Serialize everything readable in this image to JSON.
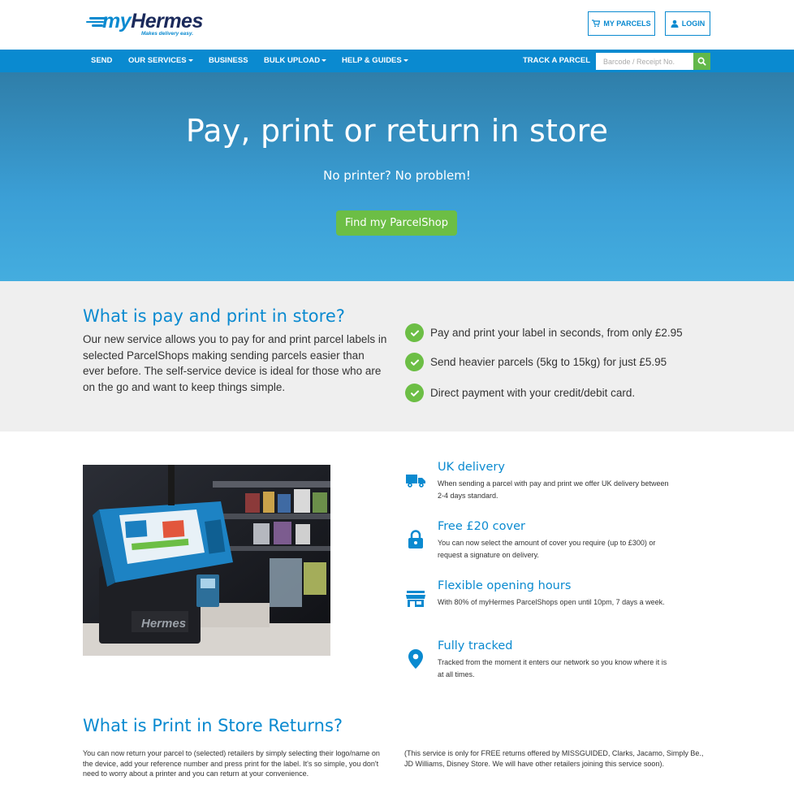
{
  "header": {
    "logo_text_my": "my",
    "logo_text_brand": "Hermes",
    "logo_tagline": "Makes delivery easy.",
    "my_parcels_label": "MY PARCELS",
    "login_label": "LOGIN"
  },
  "nav": {
    "items": [
      {
        "label": "SEND",
        "dropdown": false
      },
      {
        "label": "OUR SERVICES",
        "dropdown": true
      },
      {
        "label": "BUSINESS",
        "dropdown": false
      },
      {
        "label": "BULK UPLOAD",
        "dropdown": true
      },
      {
        "label": "HELP & GUIDES",
        "dropdown": true
      }
    ],
    "track_label": "TRACK A PARCEL",
    "track_placeholder": "Barcode / Receipt No.",
    "track_icon": "search-icon"
  },
  "hero": {
    "title": "Pay, print or return in store",
    "subtitle": "No printer? No problem!",
    "button_label": "Find my ParcelShop"
  },
  "info": {
    "title": "What is pay and print in store?",
    "text": "Our new service allows you to pay for and print parcel labels in selected ParcelShops making sending parcels easier than ever before. The self-service device is ideal for those who are on the go and want to keep things simple.",
    "checks": [
      "Pay and print your label in seconds, from only £2.95",
      "Send heavier parcels (5kg to 15kg) for just £5.95",
      "Direct payment with your credit/debit card."
    ]
  },
  "photo": {
    "kiosk_brand": "Hermes"
  },
  "features": [
    {
      "icon": "truck-icon",
      "title": "UK delivery",
      "text": "When sending a parcel with pay and print we offer UK delivery between 2-4 days standard."
    },
    {
      "icon": "lock-icon",
      "title": "Free £20 cover",
      "text": "You can now select the amount of cover you require (up to £300) or request a signature on delivery."
    },
    {
      "icon": "store-icon",
      "title": "Flexible opening hours",
      "text": "With 80% of myHermes ParcelShops open until 10pm, 7 days a week."
    },
    {
      "icon": "map-pin-icon",
      "title": "Fully tracked",
      "text": "Tracked from the moment it enters our network so you know where it is at all times."
    }
  ],
  "returns": {
    "title": "What is Print in Store Returns?",
    "left_text": "You can now return your parcel to (selected) retailers by simply selecting their logo/name on the device, add your reference number and press print for the label. It's so simple, you don't need to worry about a printer and you can return at your convenience.",
    "right_text": "(This service is only for FREE returns offered by MISSGUIDED, Clarks, Jacamo, Simply Be., JD Williams, Disney Store. We will have other retailers joining this service soon)."
  },
  "colors": {
    "brand_blue": "#0a8ad0",
    "navy": "#1b2a5b",
    "green": "#6cbe45",
    "grey_bg": "#efefef"
  }
}
